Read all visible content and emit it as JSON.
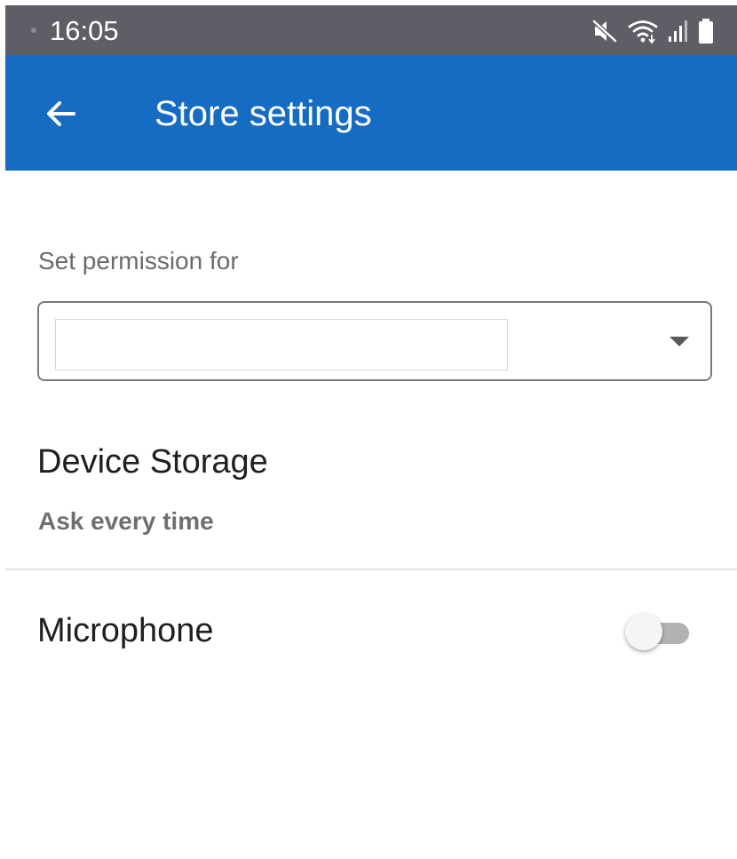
{
  "status_bar": {
    "time": "16:05",
    "icons": [
      "mute-icon",
      "wifi-icon",
      "signal-icon",
      "battery-icon"
    ],
    "background": "#5f5e66"
  },
  "app_bar": {
    "title": "Store settings",
    "back_icon": "arrow-left-icon",
    "background": "#166bc2"
  },
  "permission": {
    "label": "Set permission for",
    "selected_value": ""
  },
  "settings": {
    "device_storage": {
      "title": "Device Storage",
      "subtitle": "Ask every time"
    },
    "microphone": {
      "title": "Microphone",
      "enabled": false
    }
  }
}
